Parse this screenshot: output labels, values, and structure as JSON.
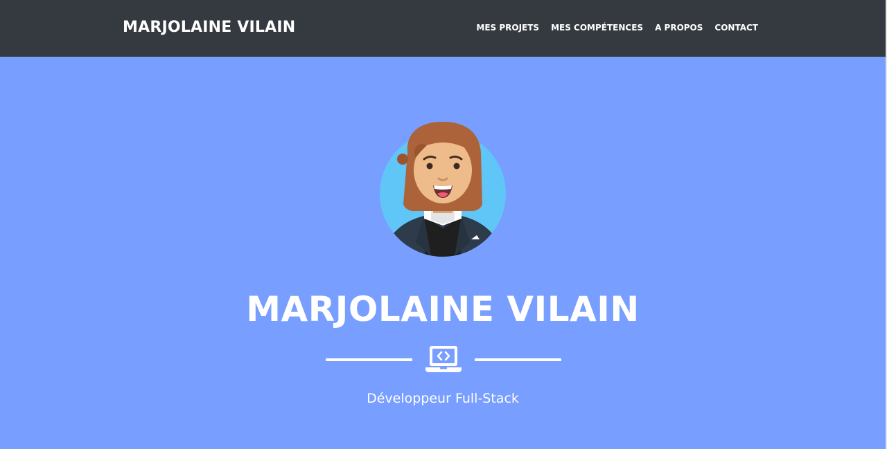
{
  "navbar": {
    "brand": "MARJOLAINE VILAIN",
    "links": [
      {
        "label": "MES PROJETS"
      },
      {
        "label": "MES COMPÉTENCES"
      },
      {
        "label": "A PROPOS"
      },
      {
        "label": "CONTACT"
      }
    ]
  },
  "hero": {
    "avatar_icon": "woman-avatar-icon",
    "title": "MARJOLAINE VILAIN",
    "divider_icon": "laptop-code-icon",
    "subtitle": "Développeur Full-Stack"
  },
  "colors": {
    "navbar_bg": "#353a40",
    "hero_bg": "#789eff",
    "text": "#ffffff",
    "avatar_circle": "#5fc6f7",
    "hair": "#ad6339",
    "skin": "#eebb8a",
    "jacket": "#2d3b4a"
  }
}
